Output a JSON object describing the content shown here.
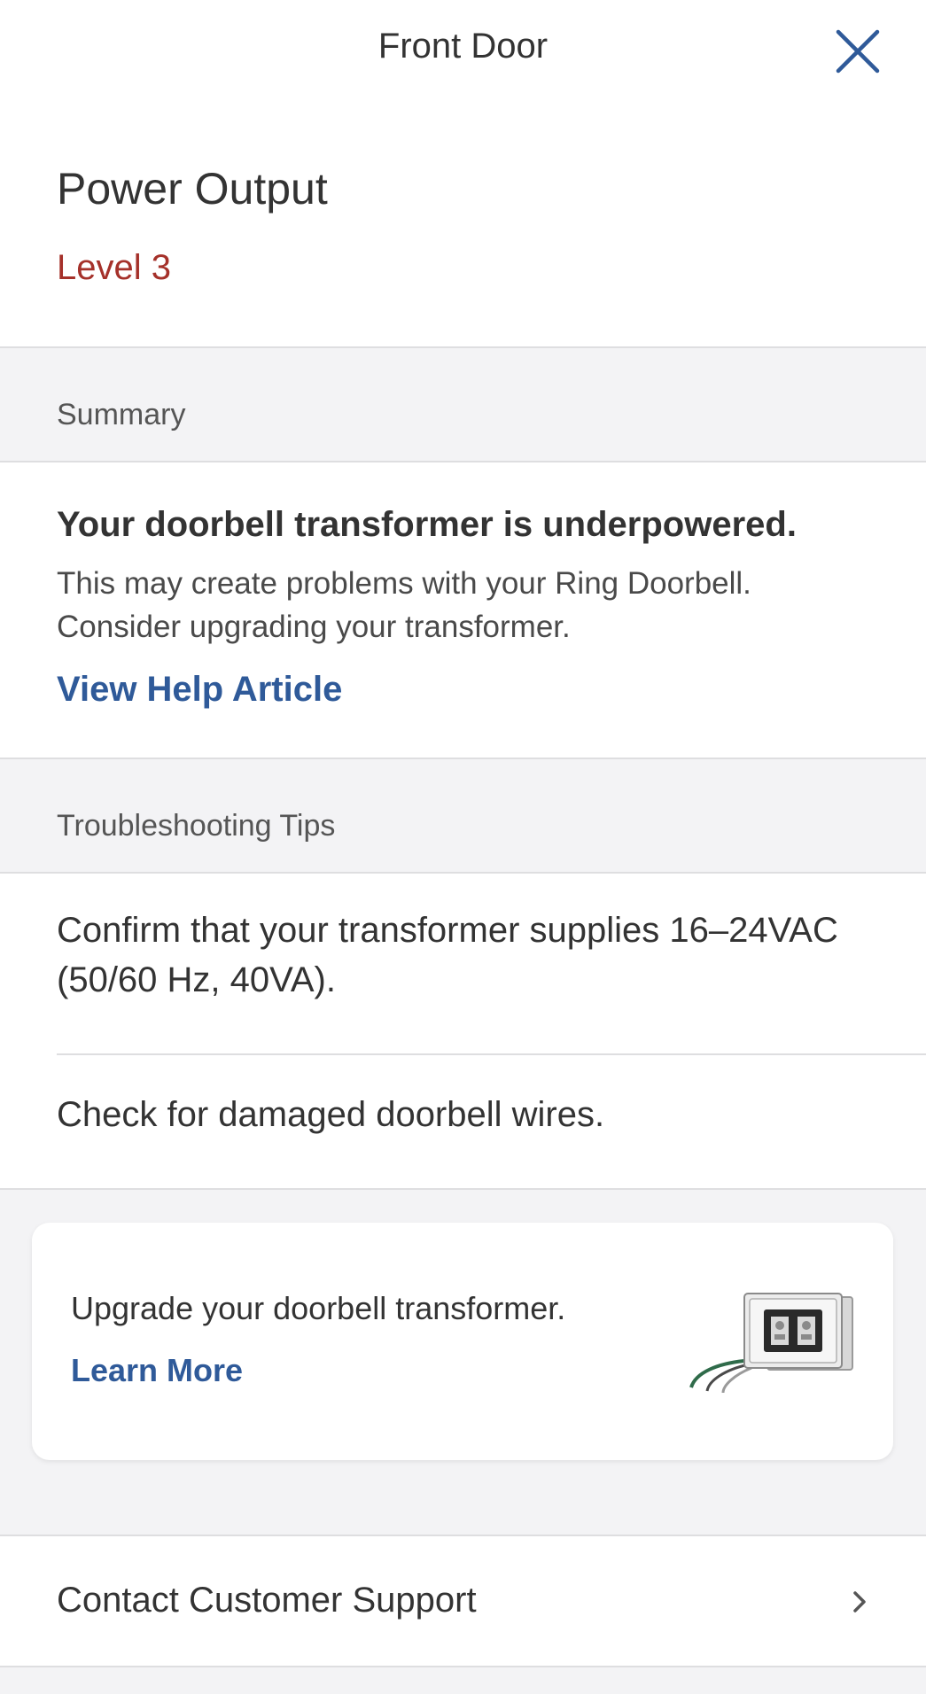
{
  "header": {
    "title": "Front Door",
    "close_icon": "close-icon"
  },
  "power": {
    "title": "Power Output",
    "level": "Level 3"
  },
  "summary": {
    "section_label": "Summary",
    "headline": "Your doorbell transformer is underpowered.",
    "body": "This may create problems with your Ring Doorbell. Consider upgrading your transformer.",
    "link_label": "View Help Article"
  },
  "tips": {
    "section_label": "Troubleshooting Tips",
    "items": [
      "Confirm that your transformer supplies 16–24VAC (50/60 Hz, 40VA).",
      "Check for damaged doorbell wires."
    ]
  },
  "promo": {
    "text": "Upgrade your doorbell transformer.",
    "link_label": "Learn More"
  },
  "support": {
    "label": "Contact Customer Support",
    "chevron_icon": "chevron-right-icon"
  },
  "colors": {
    "accent": "#2f5a99",
    "warning": "#a5312a",
    "background": "#f3f3f5",
    "divider": "#dedee0"
  }
}
